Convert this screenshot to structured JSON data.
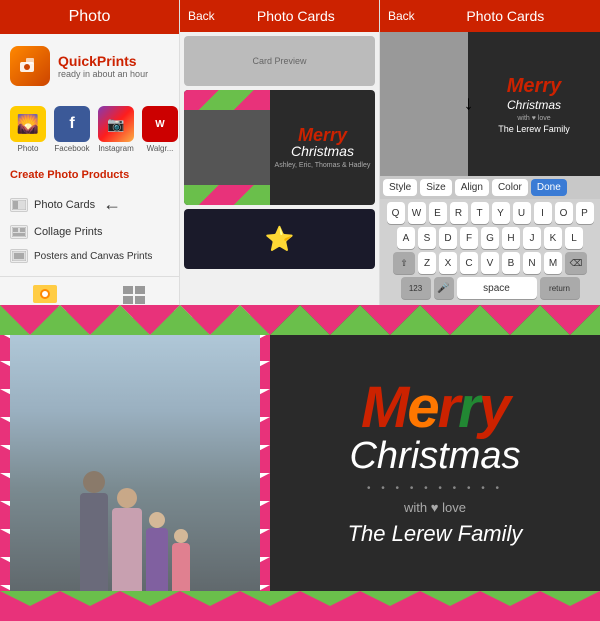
{
  "panels": {
    "panel1": {
      "header": "Photo",
      "logo": {
        "title": "QuickPrints",
        "subtitle": "ready in about an hour"
      },
      "social": [
        {
          "label": "Photo",
          "icon": "🌄"
        },
        {
          "label": "Facebook",
          "icon": "f"
        },
        {
          "label": "Instagram",
          "icon": "📷"
        },
        {
          "label": "Walgr...",
          "icon": "W"
        }
      ],
      "create_title": "Create Photo Products",
      "menu_items": [
        {
          "label": "Photo Cards",
          "arrow": true
        },
        {
          "label": "Collage Prints"
        },
        {
          "label": "Posters and Canvas Prints"
        }
      ]
    },
    "panel2": {
      "back_label": "Back",
      "title": "Photo Cards"
    },
    "panel3": {
      "back_label": "Back",
      "title": "Photo Cards",
      "toolbar": [
        "Style",
        "Size",
        "Align",
        "Color",
        "Done"
      ],
      "keyboard": {
        "row1": [
          "Q",
          "W",
          "E",
          "R",
          "T",
          "Y",
          "U",
          "I",
          "O",
          "P"
        ],
        "row2": [
          "A",
          "S",
          "D",
          "F",
          "G",
          "H",
          "J",
          "K",
          "L"
        ],
        "row3": [
          "Z",
          "X",
          "C",
          "V",
          "B",
          "N",
          "M"
        ],
        "number_row": "23",
        "space_label": "space",
        "return_label": "return"
      }
    }
  },
  "large_card": {
    "merry": "Merry",
    "christmas": "Christmas",
    "with_love": "with ♥ love",
    "family": "The Lerew Family"
  },
  "colors": {
    "red": "#cc2200",
    "dark_bg": "#2d2d2d",
    "pink_chevron": "#e8327a",
    "green_chevron": "#6abf4b",
    "red_chevron": "#cc2200"
  }
}
